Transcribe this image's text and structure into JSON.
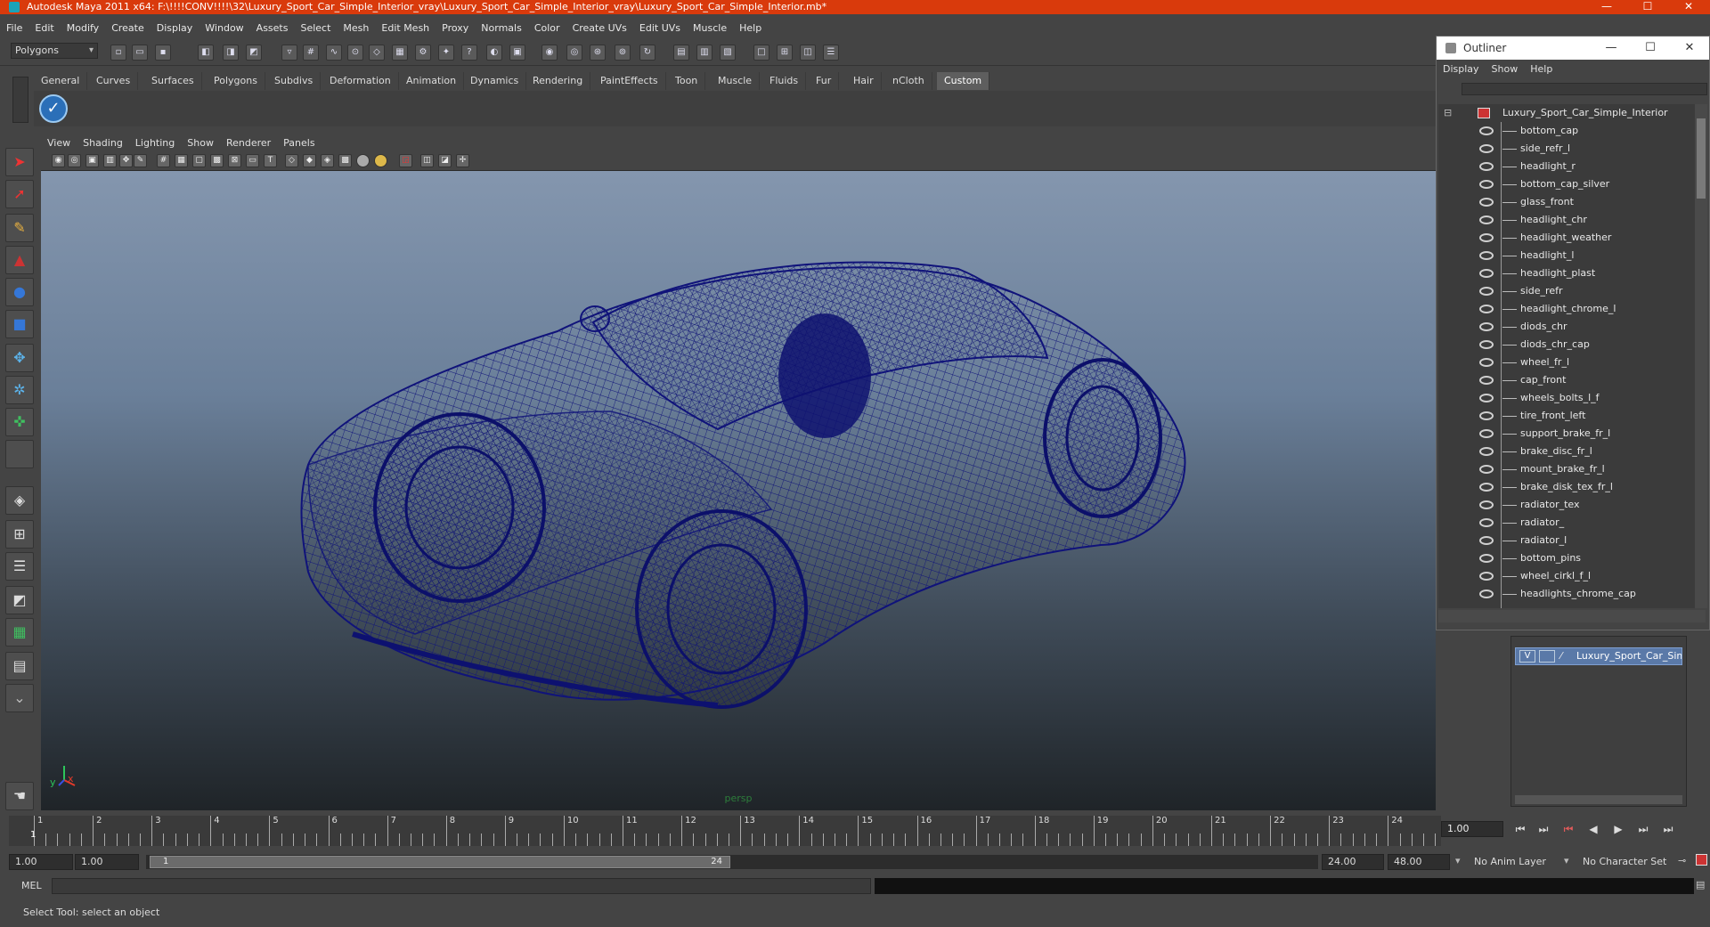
{
  "window": {
    "title": "Autodesk Maya 2011 x64: F:\\!!!!CONV!!!!\\32\\Luxury_Sport_Car_Simple_Interior_vray\\Luxury_Sport_Car_Simple_Interior_vray\\Luxury_Sport_Car_Simple_Interior.mb*",
    "minimize": "—",
    "maximize": "☐",
    "close": "✕"
  },
  "menubar": [
    "File",
    "Edit",
    "Modify",
    "Create",
    "Display",
    "Window",
    "Assets",
    "Select",
    "Mesh",
    "Edit Mesh",
    "Proxy",
    "Normals",
    "Color",
    "Create UVs",
    "Edit UVs",
    "Muscle",
    "Help"
  ],
  "toolbar": {
    "mode": "Polygons"
  },
  "shelf_tabs": [
    "General",
    "Curves",
    "Surfaces",
    "Polygons",
    "Subdivs",
    "Deformation",
    "Animation",
    "Dynamics",
    "Rendering",
    "PaintEffects",
    "Toon",
    "Muscle",
    "Fluids",
    "Fur",
    "Hair",
    "nCloth",
    "Custom"
  ],
  "shelf_active": "Custom",
  "viewport": {
    "menu": [
      "View",
      "Shading",
      "Lighting",
      "Show",
      "Renderer",
      "Panels"
    ],
    "camera_label": "persp",
    "axis_y": "y",
    "axis_x": "x",
    "wire_color": "#101478"
  },
  "outliner": {
    "title": "Outliner",
    "menu": [
      "Display",
      "Show",
      "Help"
    ],
    "root": "Luxury_Sport_Car_Simple_Interior",
    "items": [
      "bottom_cap",
      "side_refr_l",
      "headlight_r",
      "bottom_cap_silver",
      "glass_front",
      "headlight_chr",
      "headlight_weather",
      "headlight_l",
      "headlight_plast",
      "side_refr",
      "headlight_chrome_l",
      "diods_chr",
      "diods_chr_cap",
      "wheel_fr_l",
      "cap_front",
      "wheels_bolts_l_f",
      "tire_front_left",
      "support_brake_fr_l",
      "brake_disc_fr_l",
      "mount_brake_fr_l",
      "brake_disk_tex_fr_l",
      "radiator_tex",
      "radiator_",
      "radiator_l",
      "bottom_pins",
      "wheel_cirkl_f_l",
      "headlights_chrome_cap"
    ]
  },
  "layer": {
    "visible": "V",
    "name": "Luxury_Sport_Car_Simple"
  },
  "timeline": {
    "ticks": [
      "1",
      "2",
      "3",
      "4",
      "5",
      "6",
      "7",
      "8",
      "9",
      "10",
      "11",
      "12",
      "13",
      "14",
      "15",
      "16",
      "17",
      "18",
      "19",
      "20",
      "21",
      "22",
      "23",
      "24"
    ],
    "current_marker": "1",
    "current_frame": "1.00"
  },
  "playback": [
    "⏮",
    "⏭",
    "⏮",
    "◀",
    "▶",
    "⏭",
    "⏭"
  ],
  "range": {
    "start": "1.00",
    "anim_start": "1.00",
    "slider_start": "1",
    "slider_end": "24",
    "anim_end": "24.00",
    "end": "48.00",
    "anim_layer": "No Anim Layer",
    "char_set": "No Character Set"
  },
  "command": {
    "label": "MEL"
  },
  "help_line": "Select Tool: select an object"
}
